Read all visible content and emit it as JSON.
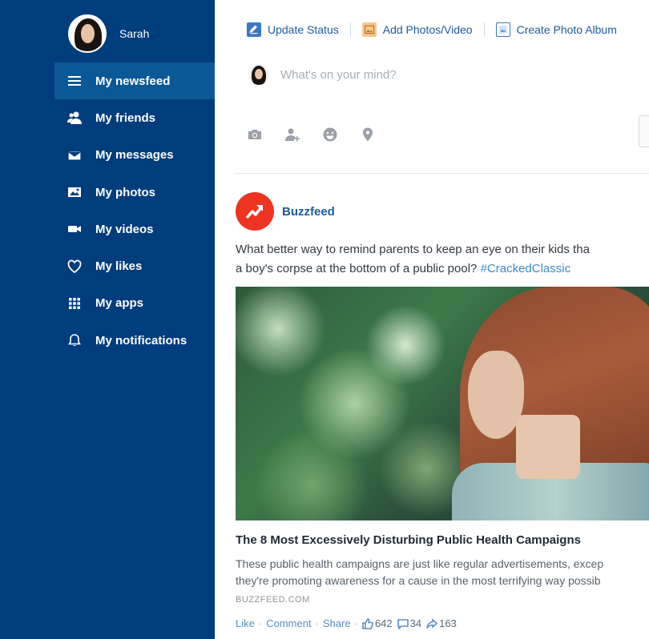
{
  "colors": {
    "sidebar": "#003d7c",
    "active": "#0b5896",
    "link": "#1d5b9e",
    "hashtag": "#3b8ad8",
    "buzzfeed": "#ee3322"
  },
  "profile": {
    "name": "Sarah"
  },
  "sidebar": {
    "items": [
      {
        "label": "My newsfeed",
        "icon": "menu-icon",
        "active": true
      },
      {
        "label": "My friends",
        "icon": "friends-icon",
        "active": false
      },
      {
        "label": "My messages",
        "icon": "envelope-icon",
        "active": false
      },
      {
        "label": "My photos",
        "icon": "photo-icon",
        "active": false
      },
      {
        "label": "My videos",
        "icon": "video-camera-icon",
        "active": false
      },
      {
        "label": "My likes",
        "icon": "heart-icon",
        "active": false
      },
      {
        "label": "My apps",
        "icon": "grid-icon",
        "active": false
      },
      {
        "label": "My notifications",
        "icon": "bell-icon",
        "active": false
      }
    ]
  },
  "composer": {
    "update_status": "Update Status",
    "add_photos": "Add Photos/Video",
    "create_album": "Create Photo Album",
    "placeholder": "What's on your mind?",
    "tools": [
      "camera-icon",
      "tag-person-icon",
      "smiley-icon",
      "location-pin-icon"
    ]
  },
  "post": {
    "author": "Buzzfeed",
    "text_line1": "What better way to remind parents to keep an eye on their kids tha",
    "text_line2": "a boy's corpse at the bottom of a public pool? ",
    "hashtag": "#CrackedClassic",
    "article_title": "The 8 Most Excessively Disturbing Public Health Campaigns",
    "article_desc_line1": "These public health campaigns are just like regular advertisements, excep",
    "article_desc_line2": "they're promoting awareness for a cause in the most terrifying way possib",
    "source": "BUZZFEED.COM",
    "like": "Like",
    "comment": "Comment",
    "share": "Share",
    "likes_count": "642",
    "comments_count": "34",
    "shares_count": "163"
  }
}
